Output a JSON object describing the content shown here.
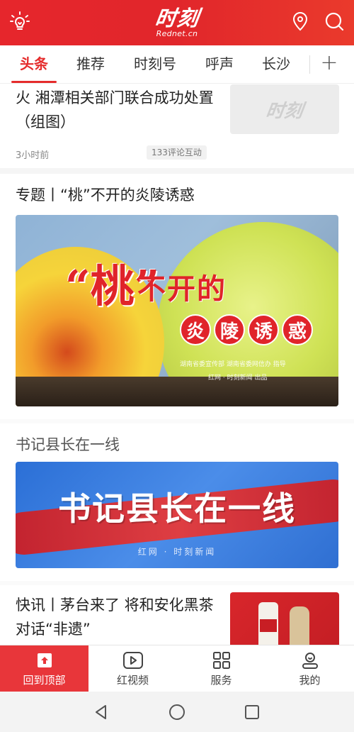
{
  "header": {
    "logo_main": "时刻",
    "logo_sub": "Rednet.cn"
  },
  "tabs": [
    {
      "label": "头条",
      "active": true
    },
    {
      "label": "推荐"
    },
    {
      "label": "时刻号"
    },
    {
      "label": "呼声"
    },
    {
      "label": "长沙"
    }
  ],
  "feed": {
    "news1": {
      "title": "火 湘潭相关部门联合成功处置（组图）",
      "time": "3小时前",
      "badge": "133评论互动",
      "thumb_text": "时刻"
    },
    "special": {
      "title": "专题丨“桃”不开的炎陵诱惑",
      "banner_big": "“桃”",
      "banner_mid": "不开的",
      "banner_words": [
        "炎",
        "陵",
        "诱",
        "惑"
      ],
      "banner_credit1": "湖南省委宣传部 湖南省委网信办 指导",
      "banner_credit2": "红网 · 时刻新闻 出品"
    },
    "secretary": {
      "title": "书记县长在一线",
      "banner_title": "书记县长在一线",
      "banner_credit": "红网 · 时刻新闻"
    },
    "news3": {
      "title": "快讯丨茅台来了 将和安化黑茶对话“非遗”"
    }
  },
  "bottom_nav": [
    {
      "label": "回到顶部",
      "icon": "back-to-top-icon",
      "active": true
    },
    {
      "label": "红视频",
      "icon": "video-play-icon"
    },
    {
      "label": "服务",
      "icon": "grid-icon"
    },
    {
      "label": "我的",
      "icon": "user-icon"
    }
  ],
  "colors": {
    "brand_red": "#e52c2c",
    "header_red": "#e1262b",
    "banner_blue": "#2b6fd6"
  }
}
